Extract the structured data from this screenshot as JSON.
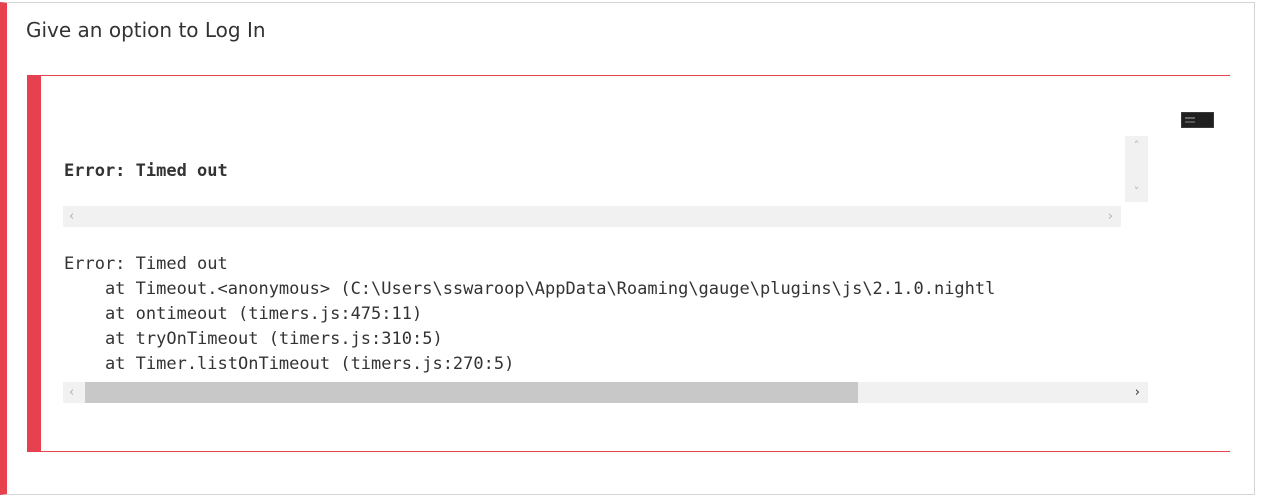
{
  "scenario": {
    "title": "Give an option to Log In"
  },
  "error": {
    "message": "Error: Timed out",
    "stacktrace": [
      "Error: Timed out",
      "    at Timeout.<anonymous> (C:\\Users\\sswaroop\\AppData\\Roaming\\gauge\\plugins\\js\\2.1.0.nightl",
      "    at ontimeout (timers.js:475:11)",
      "    at tryOnTimeout (timers.js:310:5)",
      "    at Timer.listOnTimeout (timers.js:270:5)"
    ]
  },
  "icons": {
    "screenshot": "screenshot-thumbnail-icon",
    "scroll_up": "chevron-up-icon",
    "scroll_down": "chevron-down-icon",
    "scroll_left": "chevron-left-icon",
    "scroll_right": "chevron-right-icon"
  },
  "colors": {
    "failure_accent": "#e5414f",
    "text": "#333333",
    "scrollbar_track": "#f1f1f1",
    "scrollbar_thumb": "#c8c8c8"
  }
}
